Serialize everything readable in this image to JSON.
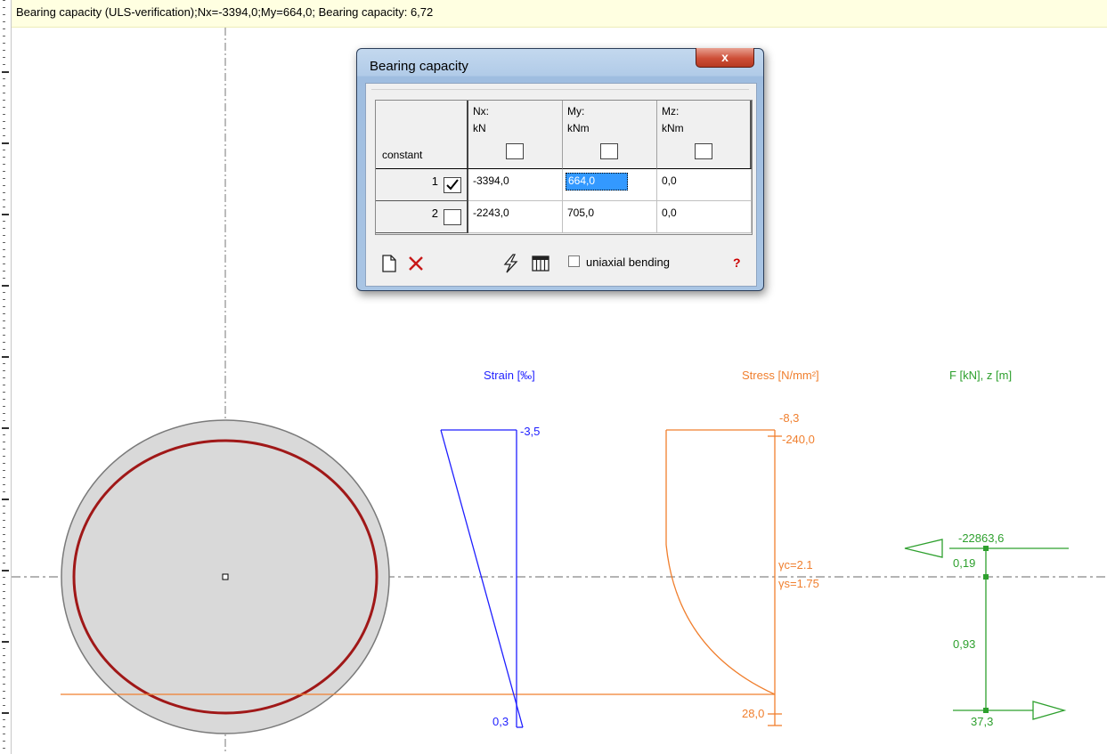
{
  "status_bar": {
    "text": "Bearing capacity (ULS-verification);Nx=-3394,0;My=664,0; Bearing capacity: 6,72"
  },
  "dialog": {
    "title": "Bearing capacity",
    "close_label": "x",
    "table": {
      "row_header_label": "constant",
      "columns": [
        {
          "name": "Nx:",
          "unit": "kN",
          "constant": false
        },
        {
          "name": "My:",
          "unit": "kNm",
          "constant": false
        },
        {
          "name": "Mz:",
          "unit": "kNm",
          "constant": false
        }
      ],
      "rows": [
        {
          "index": "1",
          "checked": true,
          "values": [
            "-3394,0",
            "664,0",
            "0,0"
          ]
        },
        {
          "index": "2",
          "checked": false,
          "values": [
            "-2243,0",
            "705,0",
            "0,0"
          ]
        }
      ],
      "selected_cell": {
        "row": 0,
        "col": 1
      }
    },
    "toolbar": {
      "new_icon": "new-page-icon",
      "delete_icon": "delete-x-icon",
      "calc_icon": "lightning-icon",
      "table_icon": "table-columns-icon",
      "uniaxial_label": "uniaxial bending",
      "uniaxial_checked": false,
      "help_label": "?"
    }
  },
  "diagrams": {
    "strain": {
      "title": "Strain [‰]",
      "top_value": "-3,5",
      "bottom_value": "0,3",
      "color": "#1f1fff"
    },
    "stress": {
      "title": "Stress [N/mm²]",
      "top_value_1": "-8,3",
      "top_value_2": "-240,0",
      "gamma_c": "γc=2.1",
      "gamma_s": "γs=1.75",
      "bottom_value": "28,0",
      "color": "#f07f2e"
    },
    "forces": {
      "title": "F [kN], z [m]",
      "compression_force": "-22863,6",
      "z_offset": "0,19",
      "lever_arm": "0,93",
      "tension_force": "37,3",
      "color": "#2ea02e"
    }
  },
  "colors": {
    "section_fill": "#d9d9d9",
    "reinforcement": "#a01818",
    "axis": "#777777",
    "status_bg": "#ffffe1"
  }
}
